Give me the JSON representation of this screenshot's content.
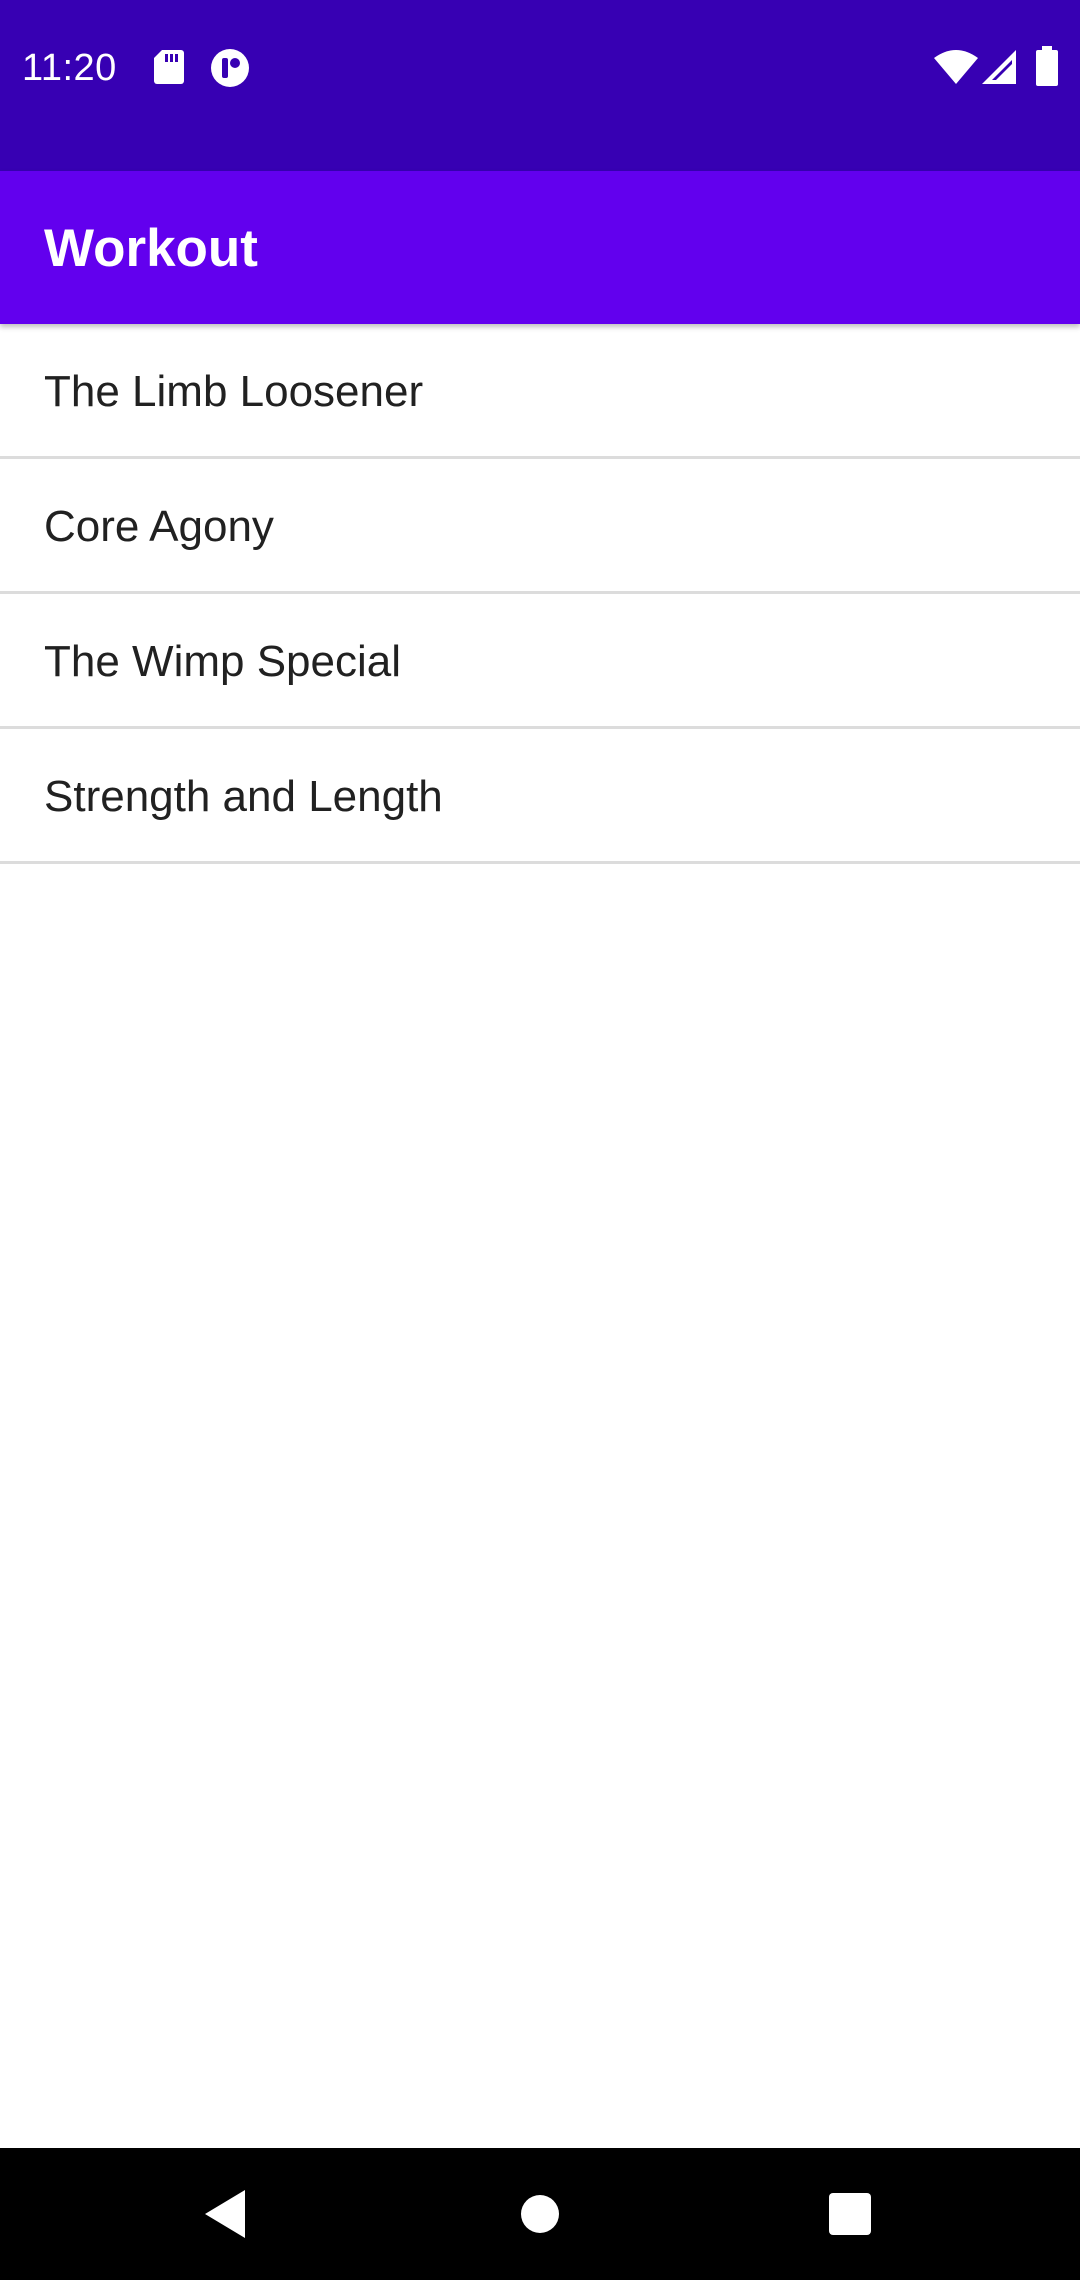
{
  "status_bar": {
    "time": "11:20",
    "left_icons": [
      "sd-card-icon",
      "vpn-key-icon"
    ],
    "right_icons": [
      "wifi-icon",
      "cell-signal-icon",
      "battery-icon"
    ]
  },
  "app_bar": {
    "title": "Workout"
  },
  "workouts": [
    {
      "label": "The Limb Loosener"
    },
    {
      "label": "Core Agony"
    },
    {
      "label": "The Wimp Special"
    },
    {
      "label": "Strength and Length"
    }
  ],
  "nav_bar": {
    "buttons": [
      "back-icon",
      "home-icon",
      "recents-icon"
    ]
  },
  "colors": {
    "status_bar": "#3700b3",
    "app_bar": "#6200ee",
    "text": "#212121",
    "divider": "#dcdcdc"
  }
}
